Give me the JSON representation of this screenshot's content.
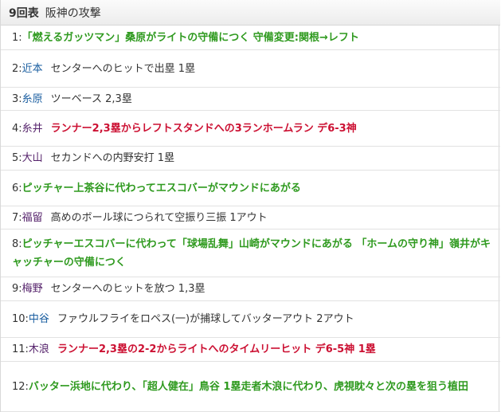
{
  "header": {
    "inning": "9回表",
    "attack": "阪神の攻撃"
  },
  "plays": [
    {
      "num": "1:",
      "name": "",
      "text": "「燃えるガッツマン」桑原がライトの守備につく 守備変更:関根→レフト",
      "name_color": "",
      "text_style": "green"
    },
    {
      "num": "2:",
      "name": "近本",
      "text": "センターへのヒットで出塁 1塁",
      "name_color": "blue",
      "text_style": "plain"
    },
    {
      "num": "3:",
      "name": "糸原",
      "text": "ツーベース 2,3塁",
      "name_color": "blue",
      "text_style": "plain"
    },
    {
      "num": "4:",
      "name": "糸井",
      "text": "ランナー2,3塁からレフトスタンドへの3ランホームラン デ6-3神",
      "name_color": "purple",
      "text_style": "red"
    },
    {
      "num": "5:",
      "name": "大山",
      "text": "セカンドへの内野安打 1塁",
      "name_color": "purple",
      "text_style": "plain"
    },
    {
      "num": "6:",
      "name": "",
      "text": "ピッチャー上茶谷に代わってエスコバーがマウンドにあがる",
      "name_color": "",
      "text_style": "green"
    },
    {
      "num": "7:",
      "name": "福留",
      "text": "高めのボール球につられて空振り三振 1アウト",
      "name_color": "purple",
      "text_style": "plain"
    },
    {
      "num": "8:",
      "name": "",
      "text": "ピッチャーエスコバーに代わって「球場乱舞」山崎がマウンドにあがる 「ホームの守り神」嶺井がキャッチャーの守備につく",
      "name_color": "",
      "text_style": "green"
    },
    {
      "num": "9:",
      "name": "梅野",
      "text": "センターへのヒットを放つ 1,3塁",
      "name_color": "purple",
      "text_style": "plain"
    },
    {
      "num": "10:",
      "name": "中谷",
      "text": "ファウルフライをロペス(一)が捕球してバッターアウト 2アウト",
      "name_color": "blue",
      "text_style": "plain"
    },
    {
      "num": "11:",
      "name": "木浪",
      "text": "ランナー2,3塁の2-2からライトへのタイムリーヒット デ6-5神 1塁",
      "name_color": "purple",
      "text_style": "red"
    },
    {
      "num": "12:",
      "name": "",
      "text": "バッター浜地に代わり、「超人健在」鳥谷 1塁走者木浪に代わり、虎視眈々と次の塁を狙う植田",
      "name_color": "",
      "text_style": "green"
    }
  ],
  "colors": {
    "green": "#2f9a1f",
    "red": "#cc1133",
    "blue": "#1a5ea0",
    "purple": "#55226b",
    "header_bg": "#efefef"
  }
}
